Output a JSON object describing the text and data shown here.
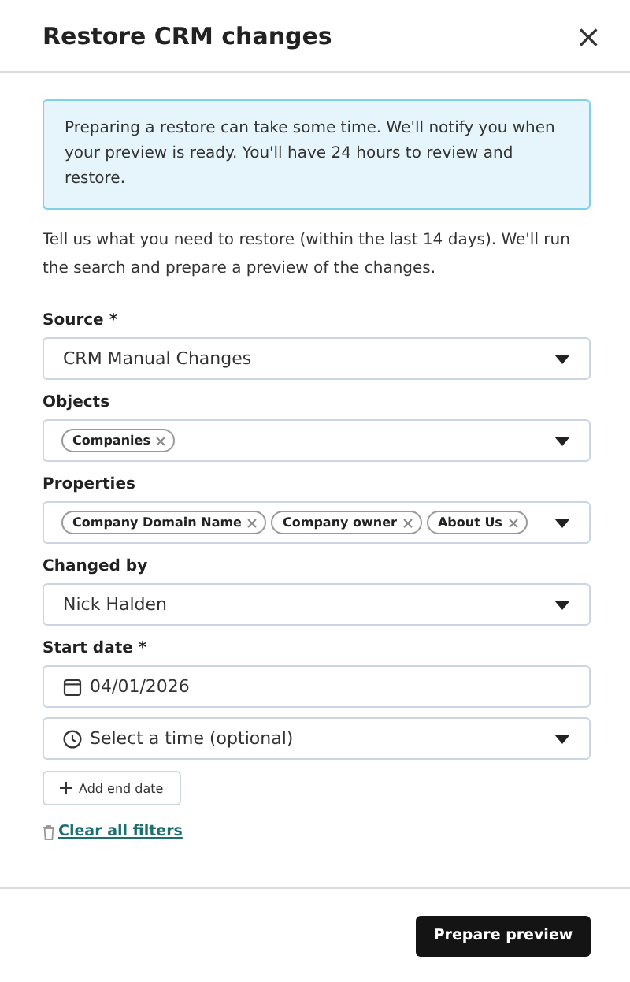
{
  "dialog": {
    "title": "Restore CRM changes",
    "close": "×"
  },
  "notice": "Preparing a restore can take some time. We'll notify you when your preview is ready. You'll have 24 hours to review and restore.",
  "intro": "Tell us what you need to restore (within the last 14 days). We'll run the search and prepare a preview of the changes.",
  "fields": [
    {
      "label": "Source *",
      "controls": [
        {
          "kind": "select",
          "value": "CRM Manual Changes"
        }
      ]
    },
    {
      "label": "Objects",
      "controls": [
        {
          "kind": "tags",
          "tags": [
            "Companies"
          ]
        }
      ]
    },
    {
      "label": "Properties",
      "controls": [
        {
          "kind": "tags",
          "tags": [
            "Company Domain Name",
            "Company owner",
            "About Us"
          ]
        }
      ]
    },
    {
      "label": "Changed by",
      "controls": [
        {
          "kind": "select",
          "value": "Nick Halden"
        }
      ]
    },
    {
      "label": "Start date *",
      "controls": [
        {
          "kind": "date",
          "value": "04/01/2026"
        },
        {
          "kind": "time",
          "placeholder": "Select a time (optional)"
        }
      ]
    }
  ],
  "add_end_date": "Add end date",
  "clear_link": "Clear all filters",
  "primary_button": "Prepare preview"
}
